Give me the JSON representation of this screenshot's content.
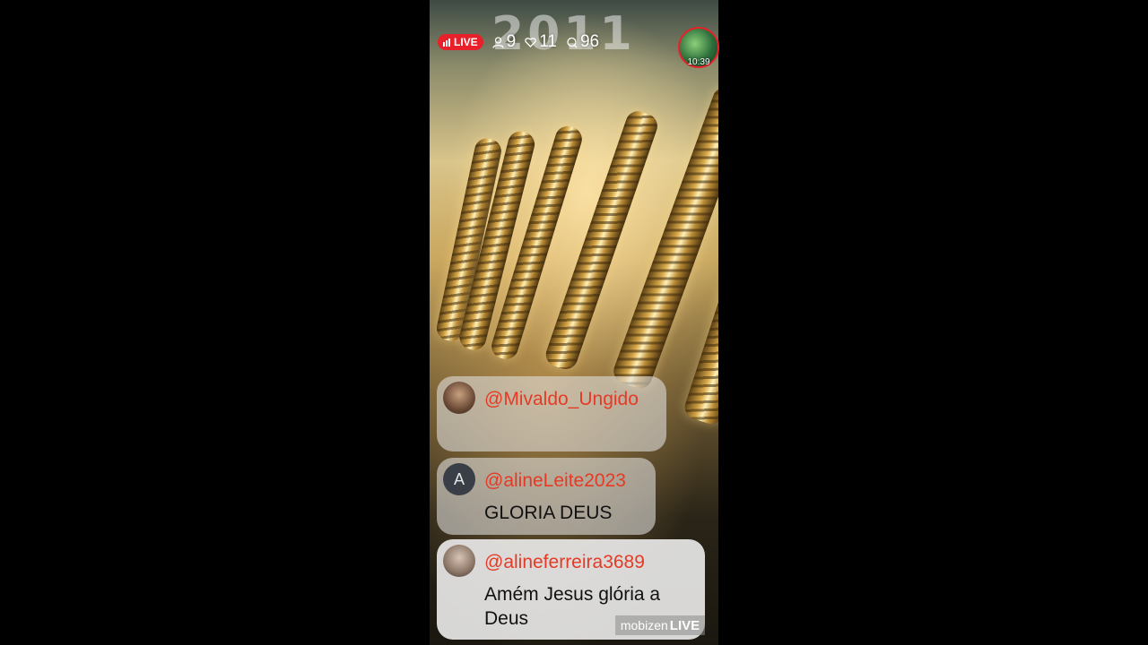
{
  "overlay": {
    "year_text": "2011"
  },
  "status": {
    "live_label": "LIVE",
    "viewers": "9",
    "likes": "11",
    "comments": "96"
  },
  "host": {
    "time_label": "10:39"
  },
  "comments": [
    {
      "username": "@Mivaldo_Ungido",
      "text": "",
      "avatar_letter": ""
    },
    {
      "username": "@alineLeite2023",
      "text": "GLORIA DEUS",
      "avatar_letter": "A"
    },
    {
      "username": "@alineferreira3689",
      "text": "Amém Jesus glória a Deus",
      "avatar_letter": ""
    }
  ],
  "watermark": {
    "brand": "mobizen",
    "suffix": "LIVE"
  },
  "colors": {
    "live_red": "#e8202a",
    "username_red": "#e53a25"
  }
}
